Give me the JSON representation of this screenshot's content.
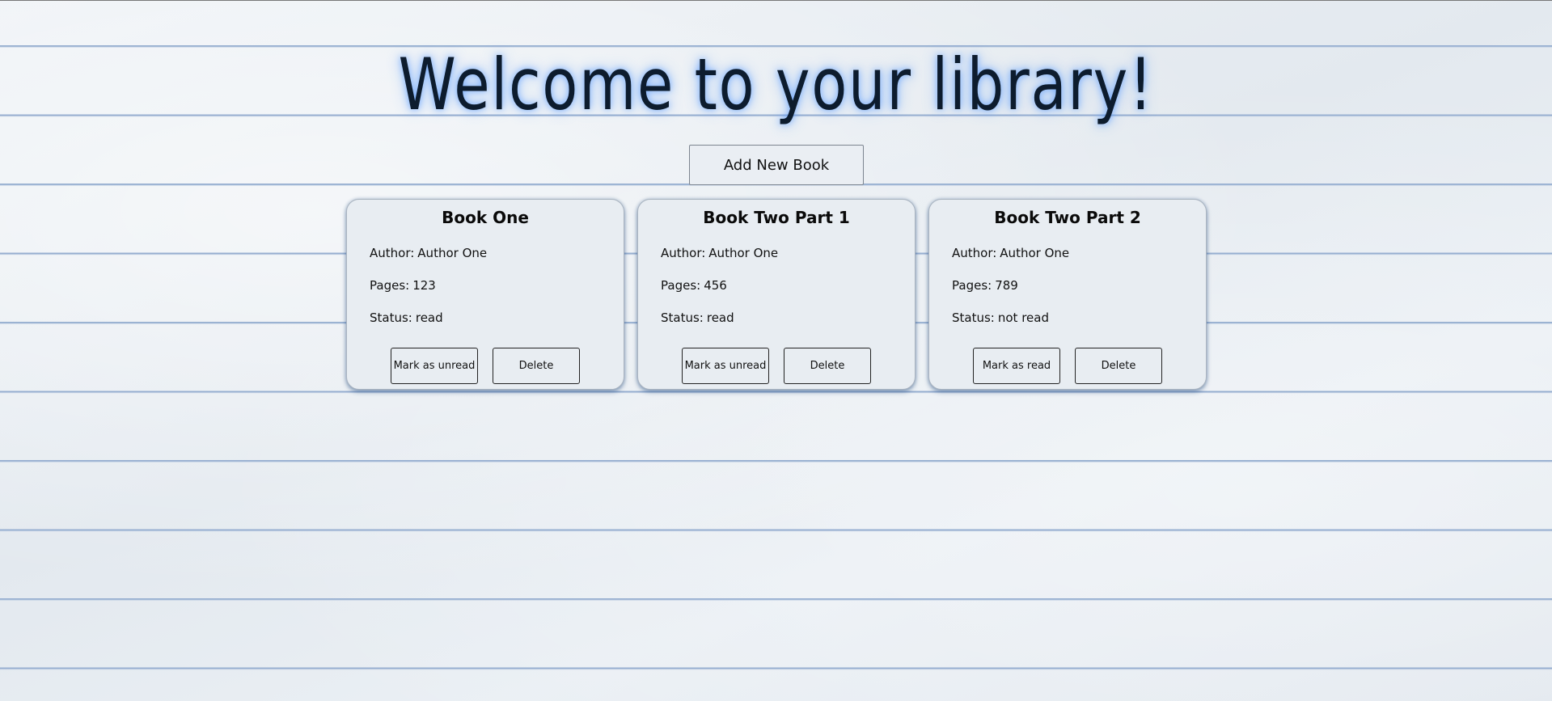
{
  "header": {
    "title": "Welcome to your library!",
    "add_button_label": "Add New Book"
  },
  "labels": {
    "author": "Author:",
    "pages": "Pages:",
    "status": "Status:",
    "delete": "Delete"
  },
  "books": [
    {
      "title": "Book One",
      "author": "Author One",
      "pages": "123",
      "status": "read",
      "toggle_label": "Mark as unread"
    },
    {
      "title": "Book Two Part 1",
      "author": "Author One",
      "pages": "456",
      "status": "read",
      "toggle_label": "Mark as unread"
    },
    {
      "title": "Book Two Part 2",
      "author": "Author One",
      "pages": "789",
      "status": "not read",
      "toggle_label": "Mark as read"
    }
  ]
}
